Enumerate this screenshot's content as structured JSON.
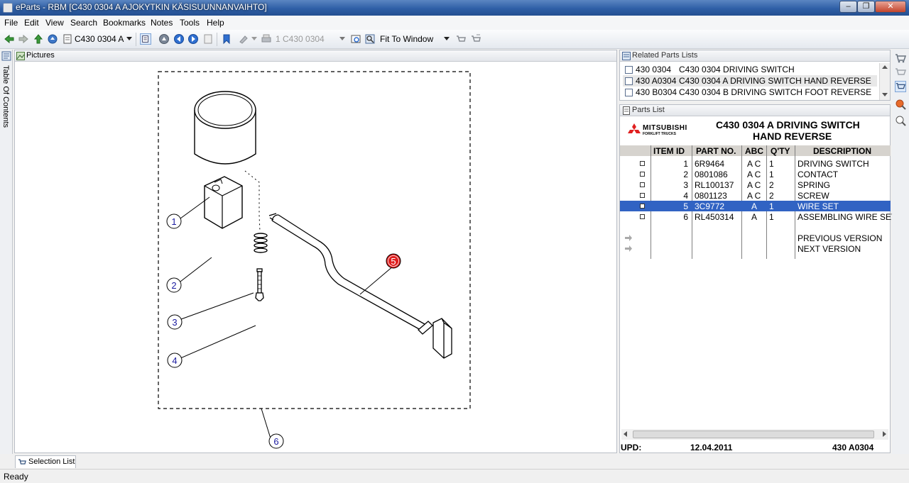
{
  "window": {
    "title": "eParts - RBM [C430 0304 A  AJOKYTKIN KÄSISUUNNANVAIHTO]"
  },
  "menu": [
    "File",
    "Edit",
    "View",
    "Search",
    "Bookmarks",
    "Notes",
    "Tools",
    "Help"
  ],
  "toolbar": {
    "doc_selector": "C430 0304 A",
    "page_selector": "1 C430 0304",
    "zoom": "Fit To Window"
  },
  "left_tab": "Table Of Contents",
  "pictures": {
    "header": "Pictures",
    "callouts": [
      "1",
      "2",
      "3",
      "4",
      "5",
      "6"
    ],
    "highlighted_callout": "5"
  },
  "related": {
    "header": "Related Parts Lists",
    "rows": [
      {
        "code": "430 0304",
        "desc": "C430 0304  DRIVING SWITCH",
        "selected": false
      },
      {
        "code": "430 A0304",
        "desc": "C430 0304 A  DRIVING SWITCH HAND REVERSE",
        "selected": true
      },
      {
        "code": "430 B0304",
        "desc": "C430 0304 B  DRIVING SWITCH FOOT REVERSE",
        "selected": false
      }
    ]
  },
  "parts": {
    "header": "Parts List",
    "logo_text": "MITSUBISHI",
    "logo_sub": "FORKLIFT TRUCKS",
    "title_line1": "C430 0304 A  DRIVING SWITCH",
    "title_line2": "HAND REVERSE",
    "columns": [
      "ITEM ID",
      "PART NO.",
      "ABC",
      "Q'TY",
      "DESCRIPTION"
    ],
    "rows": [
      {
        "id": "1",
        "part": "6R9464",
        "abc": "A C",
        "qty": "1",
        "desc": "DRIVING SWITCH",
        "selected": false
      },
      {
        "id": "2",
        "part": "0801086",
        "abc": "A C",
        "qty": "1",
        "desc": "CONTACT",
        "selected": false
      },
      {
        "id": "3",
        "part": "RL100137",
        "abc": "A C",
        "qty": "2",
        "desc": "SPRING",
        "selected": false
      },
      {
        "id": "4",
        "part": "0801123",
        "abc": "A C",
        "qty": "2",
        "desc": "SCREW",
        "selected": false
      },
      {
        "id": "5",
        "part": "3C9772",
        "abc": "A",
        "qty": "1",
        "desc": "WIRE SET",
        "selected": true
      },
      {
        "id": "6",
        "part": "RL450314",
        "abc": "A",
        "qty": "1",
        "desc": "ASSEMBLING WIRE SET",
        "selected": false
      }
    ],
    "prev_version": "PREVIOUS VERSION",
    "next_version": "NEXT VERSION",
    "footer": {
      "upd_label": "UPD:",
      "date": "12.04.2011",
      "code": "430 A0304"
    }
  },
  "selection_tab": "Selection List",
  "status": "Ready",
  "colors": {
    "selection": "#3163c3",
    "callout_highlight": "#e02020",
    "callout_normal": "#1a1aa0"
  }
}
